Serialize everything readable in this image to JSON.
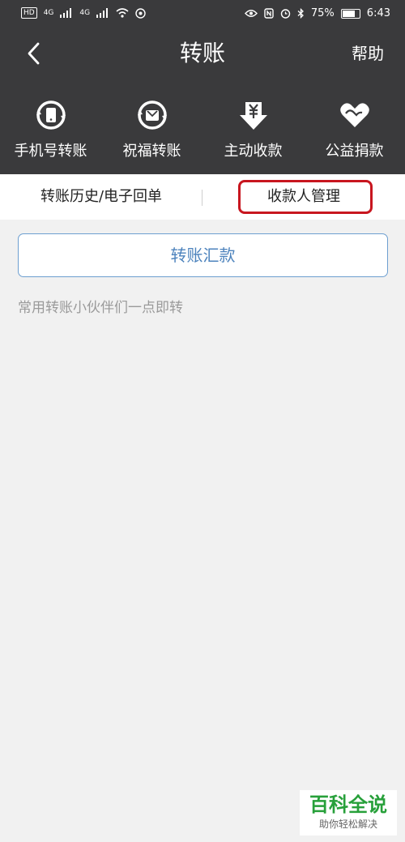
{
  "status_bar": {
    "left_badge": "HD",
    "net1": "4G",
    "net2": "4G",
    "battery_text": "75%",
    "time": "6:43"
  },
  "nav": {
    "title": "转账",
    "help": "帮助"
  },
  "quick_actions": [
    {
      "label": "手机号转账",
      "icon": "phone-transfer-icon"
    },
    {
      "label": "祝福转账",
      "icon": "gift-transfer-icon"
    },
    {
      "label": "主动收款",
      "icon": "yuan-receive-icon"
    },
    {
      "label": "公益捐款",
      "icon": "charity-heart-icon"
    }
  ],
  "tabs": {
    "history": "转账历史/电子回单",
    "payee": "收款人管理"
  },
  "main": {
    "transfer_button": "转账汇款",
    "hint": "常用转账小伙伴们一点即转"
  },
  "watermark": {
    "title": "百科全说",
    "subtitle": "助你轻松解决"
  },
  "colors": {
    "header_bg": "#3a3a3c",
    "accent_blue": "#4d83bd",
    "highlight_red": "#c8161f"
  }
}
